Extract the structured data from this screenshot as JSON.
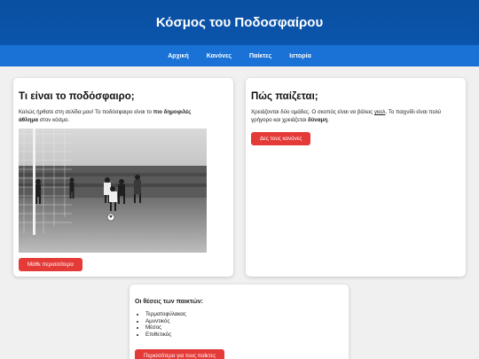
{
  "header": {
    "title": "Κόσμος του Ποδοσφαίρου"
  },
  "nav": {
    "items": [
      "Αρχική",
      "Κανόνες",
      "Παίκτες",
      "Ιστορία"
    ]
  },
  "what": {
    "heading": "Τι είναι το ποδόσφαιρο;",
    "text_1": "Καλώς ήρθατε στη σελίδα μου! Το ποδόσφαιρο είναι το ",
    "text_bold_1": "πιο δημοφιλές",
    "text_bold_2": "άθλημα",
    "text_2": " στον κόσμο.",
    "button": "Μάθε περισσότερα"
  },
  "how": {
    "heading": "Πώς παίζεται;",
    "text_1": "Χρειάζονται δύο ομάδες. Ο σκοπός είναι να βάλεις ",
    "text_link": "γκολ",
    "text_2": ". Το παιχνίδι είναι πολύ",
    "text_3": "γρήγορο και χρειάζεται ",
    "text_bold": "δύναμη",
    "text_4": ".",
    "button": "Δες τους κανόνες"
  },
  "positions": {
    "heading": "Οι θέσεις των παικτών:",
    "items": [
      "Τερματοφύλακας",
      "Αμυντικός",
      "Μέσος",
      "Επιθετικός"
    ],
    "button": "Περισσότερα για τους παίκτες"
  },
  "colors": {
    "header": "#0a4fa0",
    "nav": "#1a72d6",
    "button": "#e43b38"
  }
}
